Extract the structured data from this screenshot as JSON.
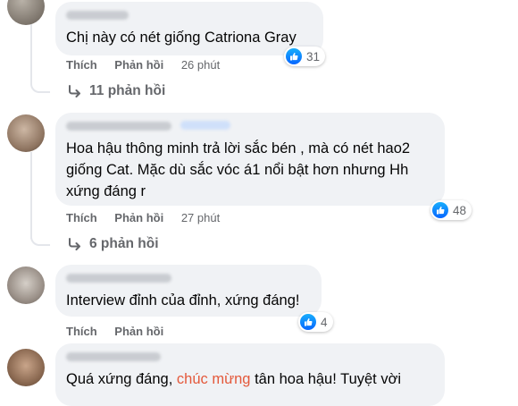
{
  "comments": [
    {
      "text": "Chị này có nét giống Catriona Gray",
      "actions": {
        "like": "Thích",
        "reply": "Phản hồi",
        "time": "26 phút"
      },
      "reaction_count": "31",
      "replies_label": "11 phản hồi"
    },
    {
      "text": "Hoa hậu thông minh trả lời sắc bén , mà có nét hao2\ngiống Cat. Mặc dù sắc vóc á1 nổi bật hơn nhưng Hh\nxứng đáng r",
      "actions": {
        "like": "Thích",
        "reply": "Phản hồi",
        "time": "27 phút"
      },
      "reaction_count": "48",
      "replies_label": "6 phản hồi"
    },
    {
      "text": "Interview đỉnh của đỉnh, xứng đáng!",
      "actions": {
        "like": "Thích",
        "reply": "Phản hồi",
        "time": ""
      },
      "reaction_count": "4"
    },
    {
      "text_before": "Quá xứng đáng, ",
      "text_highlight": "chúc mừng",
      "text_after": " tân hoa hậu! Tuyệt vời"
    }
  ],
  "colors": {
    "like_blue": "#0866ff",
    "bubble": "#f0f2f5",
    "secondary": "#65676b",
    "highlight": "#e4593b"
  },
  "icons": {
    "reaction": "like-icon",
    "reply": "reply-arrow-icon"
  }
}
